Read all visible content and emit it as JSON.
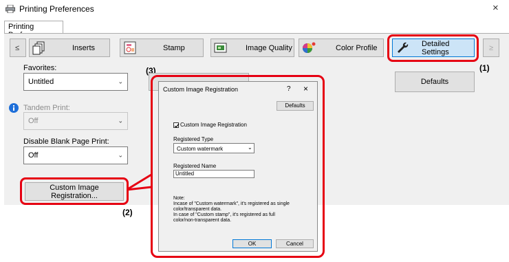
{
  "window": {
    "title": "Printing Preferences",
    "close_glyph": "×"
  },
  "tab": {
    "label": "Printing Preferences"
  },
  "toolbar": {
    "prev_glyph": "≤",
    "next_glyph": "≥",
    "buttons": [
      {
        "label": "Inserts",
        "icon": "inserts-icon"
      },
      {
        "label": "Stamp",
        "icon": "stamp-icon"
      },
      {
        "label": "Image Quality",
        "icon": "image-quality-icon"
      },
      {
        "label": "Color Profile",
        "icon": "color-profile-icon"
      },
      {
        "label": "Detailed Settings",
        "icon": "wrench-icon"
      }
    ]
  },
  "favorites": {
    "label": "Favorites:",
    "value": "Untitled"
  },
  "defaults_button": "Defaults",
  "tandem_print": {
    "label": "Tandem Print:",
    "value": "Off"
  },
  "disable_blank": {
    "label": "Disable Blank Page Print:",
    "value": "Off"
  },
  "custom_image_button": "Custom Image Registration...",
  "callouts": {
    "c1": "(1)",
    "c2": "(2)",
    "c3": "(3)"
  },
  "dialog": {
    "title": "Custom Image Registration",
    "help_glyph": "?",
    "close_glyph": "×",
    "defaults": "Defaults",
    "checkbox_label": "Custom Image Registration",
    "checkbox_checked": true,
    "registered_type_label": "Registered Type",
    "registered_type_value": "Custom watermark",
    "registered_name_label": "Registered Name",
    "registered_name_value": "Untitled",
    "note": "Note:\nIncase of \"Custom watermark\", it's registered as single\ncolor/transparent data.\nIn case of \"Custom stamp\", it's registered as full\ncolor/non-transparent data.",
    "ok": "OK",
    "cancel": "Cancel"
  },
  "colors": {
    "callout_red": "#e60012",
    "button_face": "#e1e1e1",
    "info_blue": "#1e6fd9"
  }
}
